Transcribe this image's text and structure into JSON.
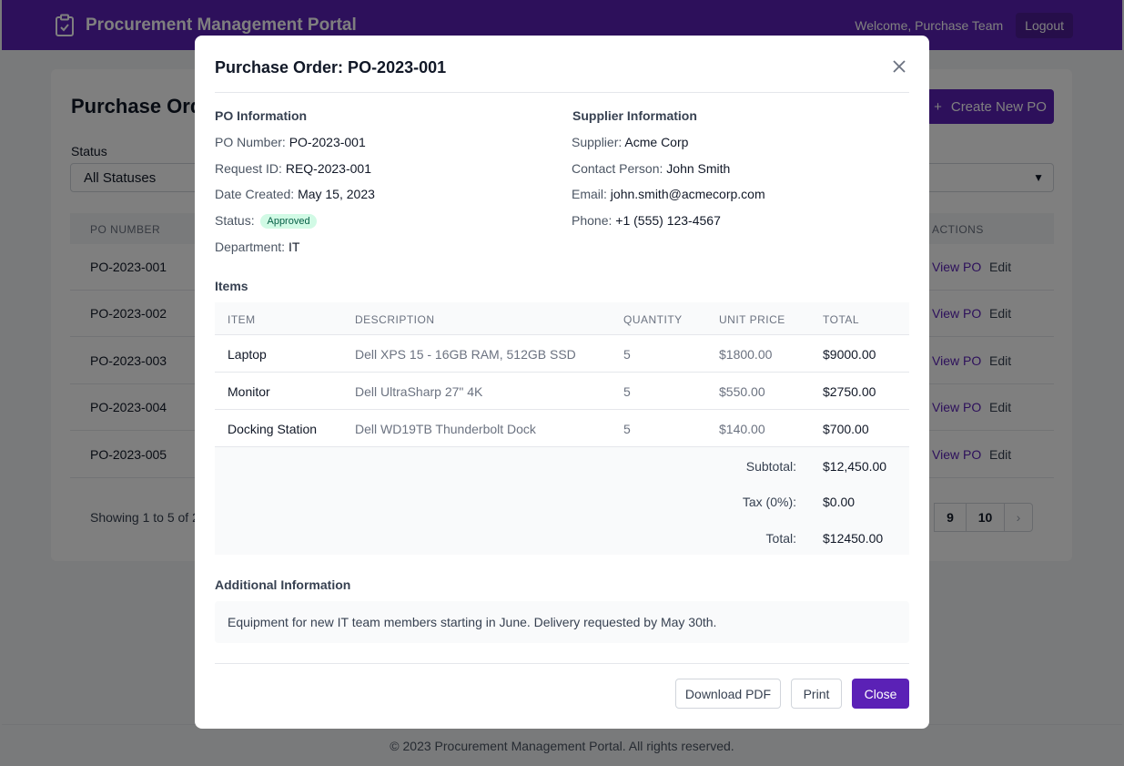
{
  "header": {
    "title": "Procurement Management Portal",
    "welcome": "Welcome, Purchase Team",
    "logout_label": "Logout"
  },
  "page": {
    "title": "Purchase Orders",
    "create_label": "Create New PO",
    "status_label": "Status",
    "status_value": "All Statuses",
    "columns": {
      "po_number": "PO NUMBER",
      "actions": "ACTIONS"
    },
    "rows": [
      {
        "po": "PO-2023-001",
        "view": "View PO",
        "edit": "Edit"
      },
      {
        "po": "PO-2023-002",
        "view": "View PO",
        "edit": "Edit"
      },
      {
        "po": "PO-2023-003",
        "view": "View PO",
        "edit": "Edit"
      },
      {
        "po": "PO-2023-004",
        "view": "View PO",
        "edit": "Edit"
      },
      {
        "po": "PO-2023-005",
        "view": "View PO",
        "edit": "Edit"
      }
    ],
    "showing": "Showing 1 to 5 of 24",
    "pages": [
      "9",
      "10"
    ],
    "next_icon": "chevron-right-icon"
  },
  "modal": {
    "title": "Purchase Order: PO-2023-001",
    "po_info": {
      "title": "PO Information",
      "po_number_label": "PO Number:",
      "po_number": "PO-2023-001",
      "request_id_label": "Request ID:",
      "request_id": "REQ-2023-001",
      "date_label": "Date Created:",
      "date": "May 15, 2023",
      "status_label": "Status:",
      "status": "Approved",
      "department_label": "Department:",
      "department": "IT"
    },
    "supplier_info": {
      "title": "Supplier Information",
      "supplier_label": "Supplier:",
      "supplier": "Acme Corp",
      "contact_label": "Contact Person:",
      "contact": "John Smith",
      "email_label": "Email:",
      "email": "john.smith@acmecorp.com",
      "phone_label": "Phone:",
      "phone": "+1 (555) 123-4567"
    },
    "items": {
      "title": "Items",
      "headers": [
        "ITEM",
        "DESCRIPTION",
        "QUANTITY",
        "UNIT PRICE",
        "TOTAL"
      ],
      "rows": [
        {
          "item": "Laptop",
          "description": "Dell XPS 15 - 16GB RAM, 512GB SSD",
          "quantity": "5",
          "unit_price": "$1800.00",
          "total": "$9000.00"
        },
        {
          "item": "Monitor",
          "description": "Dell UltraSharp 27\" 4K",
          "quantity": "5",
          "unit_price": "$550.00",
          "total": "$2750.00"
        },
        {
          "item": "Docking Station",
          "description": "Dell WD19TB Thunderbolt Dock",
          "quantity": "5",
          "unit_price": "$140.00",
          "total": "$700.00"
        }
      ],
      "subtotal_label": "Subtotal:",
      "subtotal": "$12,450.00",
      "tax_label": "Tax (0%):",
      "tax": "$0.00",
      "total_label": "Total:",
      "total": "$12450.00"
    },
    "additional": {
      "title": "Additional Information",
      "text": "Equipment for new IT team members starting in June. Delivery requested by May 30th."
    },
    "buttons": {
      "download": "Download PDF",
      "print": "Print",
      "close": "Close"
    }
  },
  "footer": {
    "text": "© 2023 Procurement Management Portal. All rights reserved."
  },
  "colors": {
    "brand": "#5b21b6",
    "badge_bg": "#d1fae5",
    "badge_text": "#065f46"
  }
}
